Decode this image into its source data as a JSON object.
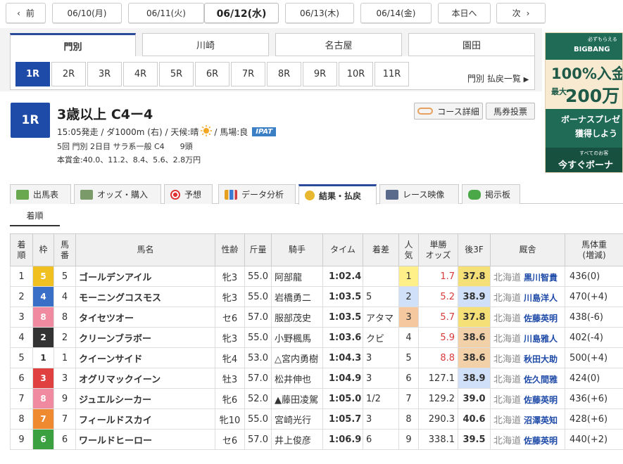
{
  "date_nav": {
    "prev": "前",
    "dates": [
      "06/10(月)",
      "06/11(火)",
      "06/12(水)",
      "06/13(木)",
      "06/14(金)"
    ],
    "active_index": 2,
    "today": "本日へ",
    "next": "次"
  },
  "venues": [
    "門別",
    "川崎",
    "名古屋",
    "園田"
  ],
  "active_venue": "門別",
  "races": [
    "1R",
    "2R",
    "3R",
    "4R",
    "5R",
    "6R",
    "7R",
    "8R",
    "9R",
    "10R",
    "11R"
  ],
  "active_race": "1R",
  "payout_link": "門別 払戻一覧",
  "ad": {
    "brand": "BIGBANG",
    "sub": "必ずもらえる",
    "line1": "100%入金",
    "line2a": "最大",
    "line2b": "200万",
    "band1": "ボーナスプレゼ",
    "band2": "獲得しよう",
    "cta_small": "すべてのお客",
    "cta": "今すぐボーナ"
  },
  "race": {
    "number": "1R",
    "title": "3歳以上 C4ー4",
    "info_pre": "15:05発走 / ダ1000m (右) / 天候:晴",
    "info_post": "/ 馬場:良",
    "ipat": "IPAT",
    "info2": "5回 門別 2日目 サラ系一般 C4　　9頭",
    "prize": "本賞金:40.0、11.2、8.4、5.6、2.8万円"
  },
  "buttons": {
    "course": "コース詳細",
    "vote": "馬券投票"
  },
  "tabs": [
    "出馬表",
    "オッズ・購入",
    "予想",
    "データ分析",
    "結果・払戻",
    "レース映像",
    "掲示板"
  ],
  "active_tab": "結果・払戻",
  "subtab": "着順",
  "table": {
    "headers": [
      "着\n順",
      "枠",
      "馬\n番",
      "馬名",
      "性齢",
      "斤量",
      "騎手",
      "タイム",
      "着差",
      "人\n気",
      "単勝\nオッズ",
      "後3F",
      "厩舎",
      "馬体重\n(増減)"
    ],
    "rows": [
      {
        "rank": "1",
        "waku": "5",
        "num": "5",
        "horse": "ゴールデンアイル",
        "sex": "牝3",
        "weight": "55.0",
        "jockey": "阿部龍",
        "time": "1:02.4",
        "margin": "",
        "pop": "1",
        "odds": "1.7",
        "l3f": "37.8",
        "region": "北海道",
        "trainer": "黒川智貴",
        "bw": "436(0)"
      },
      {
        "rank": "2",
        "waku": "4",
        "num": "4",
        "horse": "モーニングコスモス",
        "sex": "牝3",
        "weight": "55.0",
        "jockey": "岩橋勇二",
        "time": "1:03.5",
        "margin": "5",
        "pop": "2",
        "odds": "5.2",
        "l3f": "38.9",
        "region": "北海道",
        "trainer": "川島洋人",
        "bw": "470(+4)"
      },
      {
        "rank": "3",
        "waku": "8",
        "num": "8",
        "horse": "タイセツオー",
        "sex": "セ6",
        "weight": "57.0",
        "jockey": "服部茂史",
        "time": "1:03.5",
        "margin": "アタマ",
        "pop": "3",
        "odds": "5.7",
        "l3f": "37.8",
        "region": "北海道",
        "trainer": "佐藤英明",
        "bw": "438(-6)"
      },
      {
        "rank": "4",
        "waku": "2",
        "num": "2",
        "horse": "クリーンブラボー",
        "sex": "牝3",
        "weight": "55.0",
        "jockey": "小野楓馬",
        "time": "1:03.6",
        "margin": "クビ",
        "pop": "4",
        "odds": "5.9",
        "l3f": "38.6",
        "region": "北海道",
        "trainer": "川島雅人",
        "bw": "402(-4)"
      },
      {
        "rank": "5",
        "waku": "1",
        "num": "1",
        "horse": "クイーンサイド",
        "sex": "牝4",
        "weight": "53.0",
        "jockey": "△宮内勇樹",
        "time": "1:04.3",
        "margin": "3",
        "pop": "5",
        "odds": "8.8",
        "l3f": "38.6",
        "region": "北海道",
        "trainer": "秋田大助",
        "bw": "500(+4)"
      },
      {
        "rank": "6",
        "waku": "3",
        "num": "3",
        "horse": "オグリマックイーン",
        "sex": "牡3",
        "weight": "57.0",
        "jockey": "松井伸也",
        "time": "1:04.9",
        "margin": "3",
        "pop": "6",
        "odds": "127.1",
        "l3f": "38.9",
        "region": "北海道",
        "trainer": "佐久間雅",
        "bw": "424(0)"
      },
      {
        "rank": "7",
        "waku": "8",
        "num": "9",
        "horse": "ジュエルシーカー",
        "sex": "牝6",
        "weight": "52.0",
        "jockey": "▲藤田凌駕",
        "time": "1:05.0",
        "margin": "1/2",
        "pop": "7",
        "odds": "129.2",
        "l3f": "39.0",
        "region": "北海道",
        "trainer": "佐藤英明",
        "bw": "436(+6)"
      },
      {
        "rank": "8",
        "waku": "7",
        "num": "7",
        "horse": "フィールドスカイ",
        "sex": "牝10",
        "weight": "55.0",
        "jockey": "宮崎光行",
        "time": "1:05.7",
        "margin": "3",
        "pop": "8",
        "odds": "290.3",
        "l3f": "40.6",
        "region": "北海道",
        "trainer": "沼澤英知",
        "bw": "428(+6)"
      },
      {
        "rank": "9",
        "waku": "6",
        "num": "6",
        "horse": "ワールドヒーロー",
        "sex": "セ6",
        "weight": "57.0",
        "jockey": "井上俊彦",
        "time": "1:06.9",
        "margin": "6",
        "pop": "9",
        "odds": "338.1",
        "l3f": "39.5",
        "region": "北海道",
        "trainer": "佐藤英明",
        "bw": "440(+2)"
      }
    ]
  },
  "colors": {
    "accent": "#1e4aa8",
    "waku": {
      "1": "#ffffff",
      "2": "#333333",
      "3": "#e04040",
      "4": "#3a6fc8",
      "5": "#f0c020",
      "6": "#3aa040",
      "7": "#f08a30",
      "8": "#f08aa0"
    },
    "pop_highlight": {
      "1": "#fff08a",
      "2": "#cfe0f8",
      "3": "#f5c8a0"
    },
    "l3f_rank": {
      "1": "#f5e078",
      "2": "#f2d0a8",
      "3": "#cfe0f8"
    }
  }
}
